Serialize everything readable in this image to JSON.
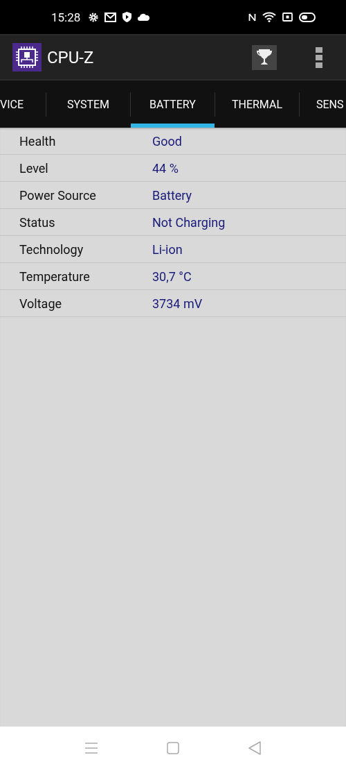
{
  "status_bar": {
    "time": "15:28"
  },
  "app_bar": {
    "title": "CPU-Z"
  },
  "tabs": [
    {
      "label": "VICE",
      "selected": false
    },
    {
      "label": "SYSTEM",
      "selected": false
    },
    {
      "label": "BATTERY",
      "selected": true
    },
    {
      "label": "THERMAL",
      "selected": false
    },
    {
      "label": "SENS",
      "selected": false
    }
  ],
  "rows": [
    {
      "label": "Health",
      "value": "Good"
    },
    {
      "label": "Level",
      "value": "44 %"
    },
    {
      "label": "Power Source",
      "value": "Battery"
    },
    {
      "label": "Status",
      "value": "Not Charging"
    },
    {
      "label": "Technology",
      "value": "Li-ion"
    },
    {
      "label": "Temperature",
      "value": "30,7 °C"
    },
    {
      "label": "Voltage",
      "value": "3734 mV"
    }
  ]
}
